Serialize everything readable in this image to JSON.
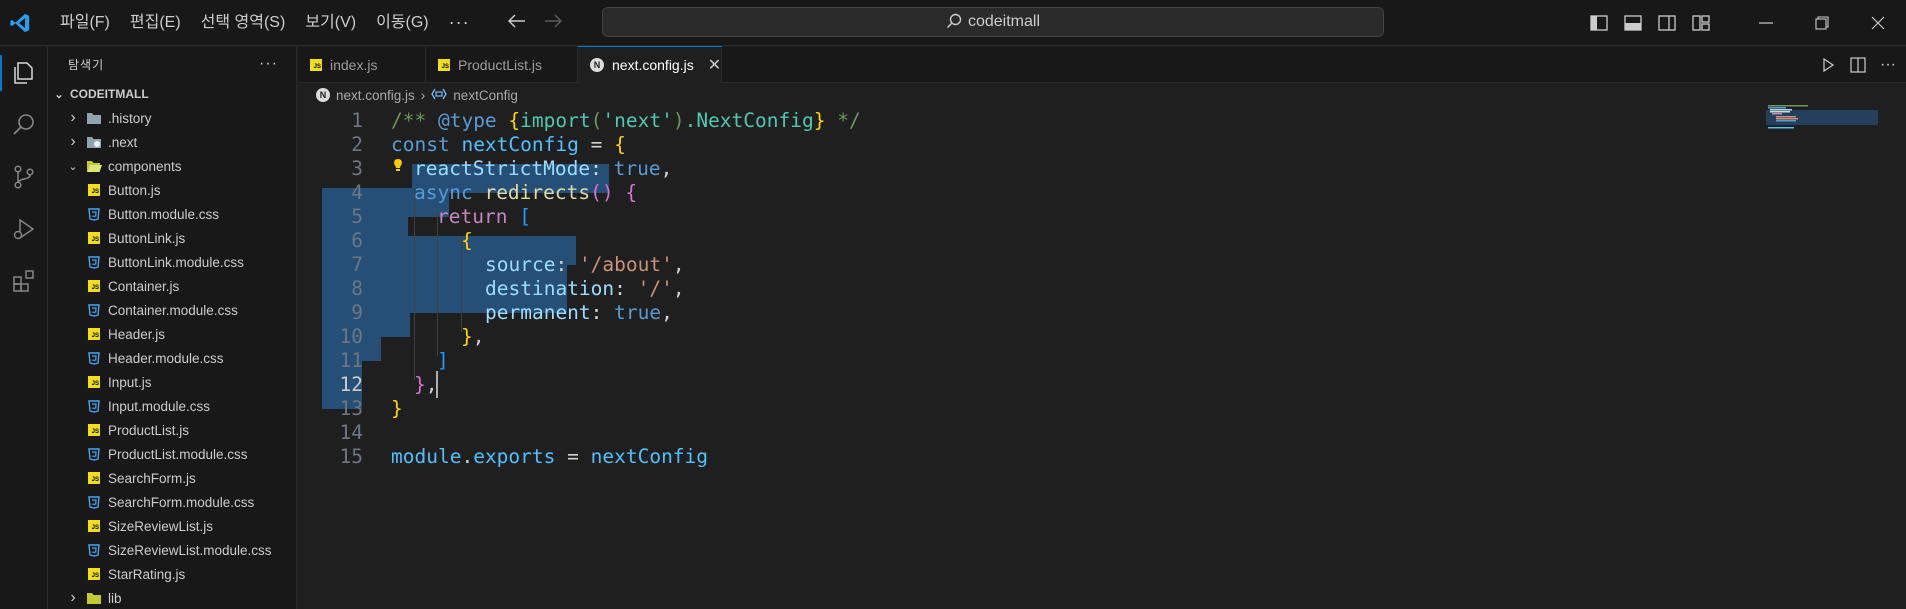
{
  "menu": [
    "파일(F)",
    "편집(E)",
    "선택 영역(S)",
    "보기(V)",
    "이동(G)"
  ],
  "menu_more": "···",
  "search": {
    "text": "codeitmall"
  },
  "sidebar": {
    "title": "탐색기",
    "more": "···",
    "root": "CODEITMALL",
    "items": [
      {
        "label": ".history",
        "kind": "folder",
        "expanded": false
      },
      {
        "label": ".next",
        "kind": "folder",
        "expanded": false
      },
      {
        "label": "components",
        "kind": "folder",
        "expanded": true
      },
      {
        "label": "Button.js",
        "kind": "js"
      },
      {
        "label": "Button.module.css",
        "kind": "css"
      },
      {
        "label": "ButtonLink.js",
        "kind": "js"
      },
      {
        "label": "ButtonLink.module.css",
        "kind": "css"
      },
      {
        "label": "Container.js",
        "kind": "js"
      },
      {
        "label": "Container.module.css",
        "kind": "css"
      },
      {
        "label": "Header.js",
        "kind": "js"
      },
      {
        "label": "Header.module.css",
        "kind": "css"
      },
      {
        "label": "Input.js",
        "kind": "js"
      },
      {
        "label": "Input.module.css",
        "kind": "css"
      },
      {
        "label": "ProductList.js",
        "kind": "js"
      },
      {
        "label": "ProductList.module.css",
        "kind": "css"
      },
      {
        "label": "SearchForm.js",
        "kind": "js"
      },
      {
        "label": "SearchForm.module.css",
        "kind": "css"
      },
      {
        "label": "SizeReviewList.js",
        "kind": "js"
      },
      {
        "label": "SizeReviewList.module.css",
        "kind": "css"
      },
      {
        "label": "StarRating.js",
        "kind": "js"
      },
      {
        "label": "lib",
        "kind": "folder",
        "expanded": false
      }
    ]
  },
  "tabs": [
    {
      "label": "index.js",
      "icon": "js",
      "active": false
    },
    {
      "label": "ProductList.js",
      "icon": "js",
      "active": false
    },
    {
      "label": "next.config.js",
      "icon": "next",
      "active": true,
      "close": "✕"
    }
  ],
  "breadcrumb": {
    "file": "next.config.js",
    "sep": "›",
    "symbol": "nextConfig"
  },
  "editor": {
    "line_numbers": [
      "1",
      "2",
      "3",
      "4",
      "5",
      "6",
      "7",
      "8",
      "9",
      "10",
      "11",
      "12",
      "13",
      "14",
      "15"
    ],
    "current_line": "12",
    "selection_color": "#264f78",
    "code": {
      "l1": [
        "/** ",
        "@type",
        " ",
        "{",
        "import",
        "(",
        "'next'",
        ")",
        ".",
        "NextConfig",
        "}",
        " */"
      ],
      "l2": [
        "const",
        " ",
        "nextConfig",
        " = ",
        "{"
      ],
      "l3": [
        "reactStrictMode",
        ": ",
        "true",
        ","
      ],
      "l4": [
        "async",
        " ",
        "redirects",
        "()",
        " ",
        "{"
      ],
      "l5": [
        "return",
        " ",
        "["
      ],
      "l6": [
        "{"
      ],
      "l7": [
        "source",
        ": ",
        "'/about'",
        ","
      ],
      "l8": [
        "destination",
        ": ",
        "'/'",
        ","
      ],
      "l9": [
        "permanent",
        ": ",
        "true",
        ","
      ],
      "l10": [
        "}",
        ","
      ],
      "l11": [
        "]"
      ],
      "l12": [
        "}",
        ","
      ],
      "l13": [
        "}"
      ],
      "l15": [
        "module",
        ".",
        "exports",
        " = ",
        "nextConfig"
      ]
    }
  },
  "colors": {
    "accent": "#0078d4",
    "js_icon": "#f5de19",
    "css_icon": "#42a5f5",
    "folder": "#90a4ae"
  }
}
